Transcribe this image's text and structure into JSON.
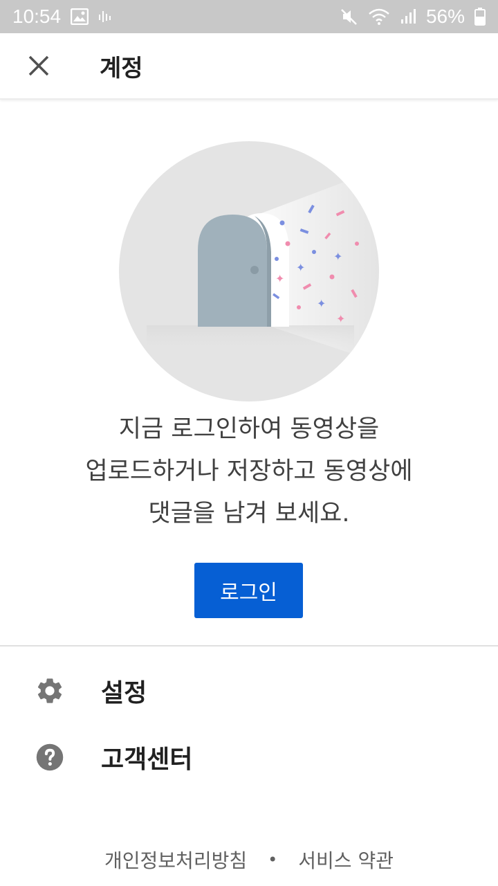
{
  "status_bar": {
    "time": "10:54",
    "battery": "56%",
    "icons": [
      "image-icon",
      "audio-bars-icon",
      "mute-icon",
      "wifi-icon",
      "signal-icon",
      "battery-icon"
    ]
  },
  "app_bar": {
    "close_icon": "close-icon",
    "title": "계정"
  },
  "hero": {
    "illustration": "door-with-confetti-illustration",
    "colors": {
      "circle": "#e4e4e4",
      "door": "#a0b1bb",
      "confetti_blue": "#7b8fe0",
      "confetti_pink": "#f08cae"
    }
  },
  "message": {
    "line1": "지금 로그인하여 동영상을",
    "line2": "업로드하거나 저장하고 동영상에",
    "line3": "댓글을 남겨 보세요."
  },
  "login_button": {
    "label": "로그인",
    "color": "#065fd4"
  },
  "menu": {
    "items": [
      {
        "label": "설정",
        "icon": "gear-icon"
      },
      {
        "label": "고객센터",
        "icon": "help-icon"
      }
    ]
  },
  "footer": {
    "privacy": "개인정보처리방침",
    "separator": "•",
    "terms": "서비스 약관"
  }
}
